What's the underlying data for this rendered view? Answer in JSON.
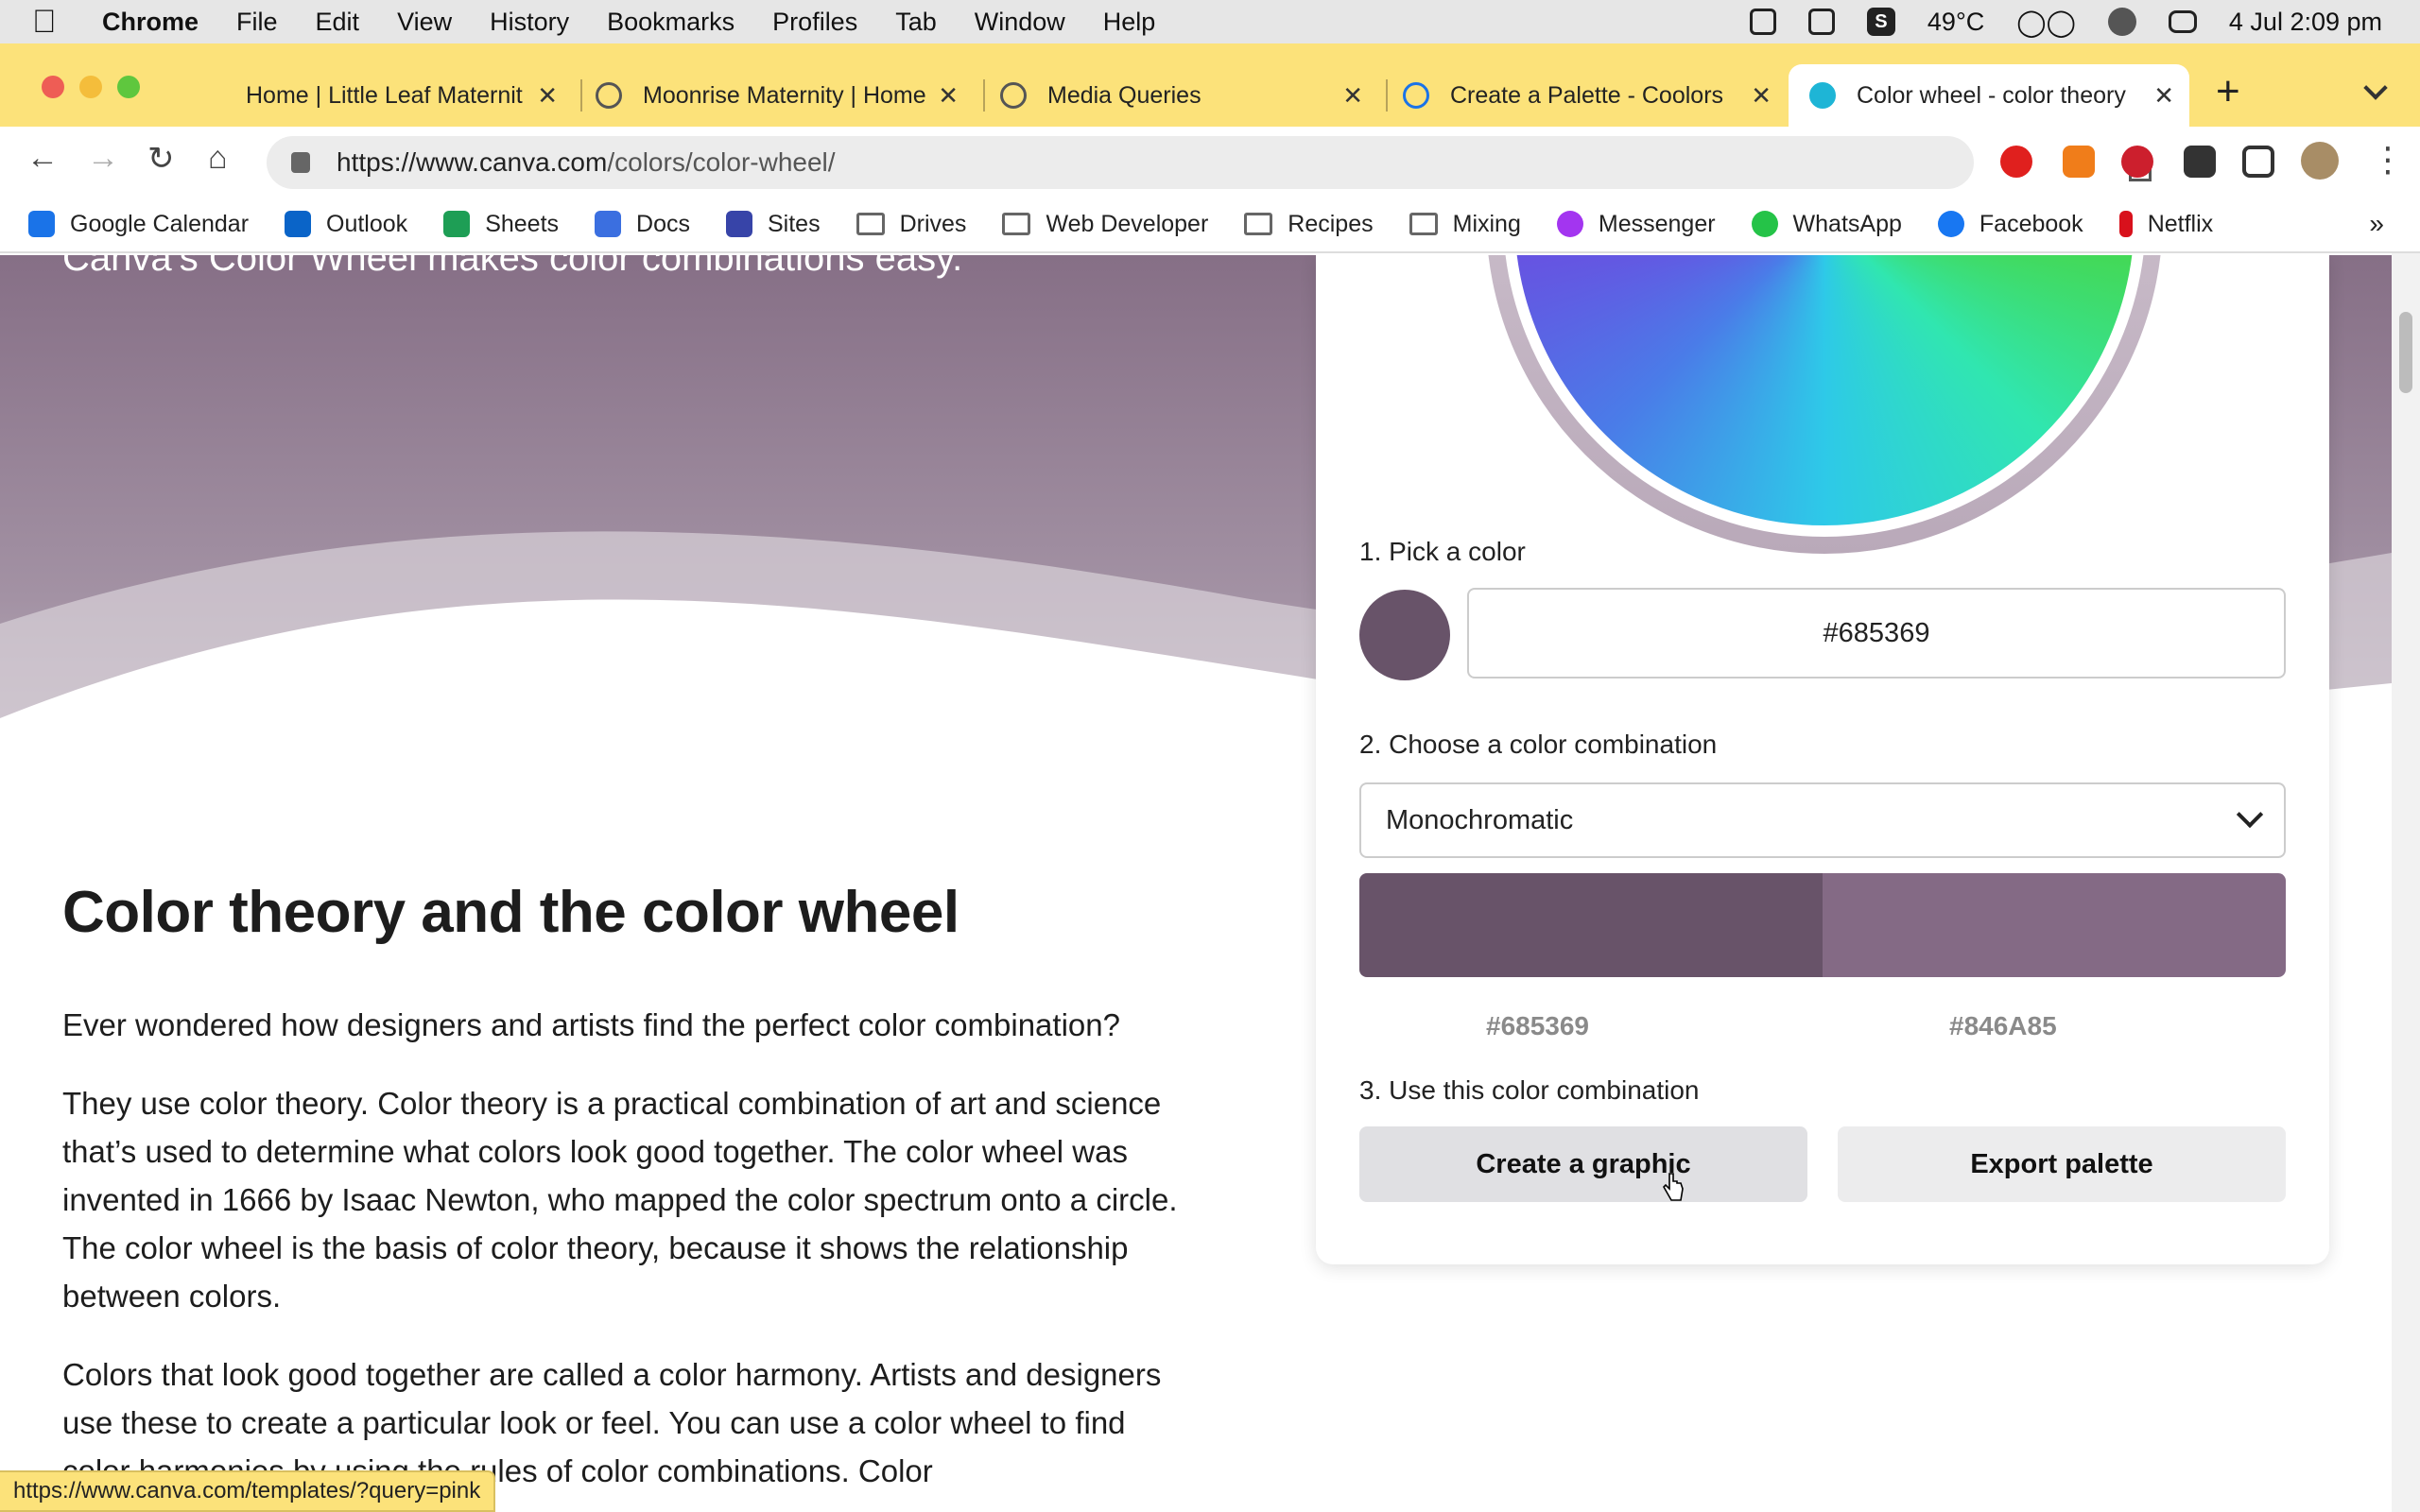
{
  "menubar": {
    "app": "Chrome",
    "items": [
      "File",
      "Edit",
      "View",
      "History",
      "Bookmarks",
      "Profiles",
      "Tab",
      "Window",
      "Help"
    ],
    "status": {
      "s_badge": "S",
      "temperature": "49°C",
      "datetime": "4 Jul  2:09 pm"
    }
  },
  "tabs": [
    {
      "title": "Home | Little Leaf Maternit",
      "icon": "leaf-favicon"
    },
    {
      "title": "Moonrise Maternity | Home",
      "icon": "globe-favicon"
    },
    {
      "title": "Media Queries",
      "icon": "globe-favicon"
    },
    {
      "title": "Create a Palette - Coolors",
      "icon": "coolors-favicon"
    },
    {
      "title": "Color wheel - color theory",
      "icon": "canva-favicon",
      "active": true
    }
  ],
  "omnibox": {
    "url_prefix": "https://www.canva.com",
    "url_path": "/colors/color-wheel/"
  },
  "bookmarks": [
    {
      "label": "Google Calendar",
      "icon": "calendar-icon",
      "color": "#1a73e8"
    },
    {
      "label": "Outlook",
      "icon": "outlook-icon",
      "color": "#0a64c8"
    },
    {
      "label": "Sheets",
      "icon": "sheets-icon",
      "color": "#1e9e55"
    },
    {
      "label": "Docs",
      "icon": "docs-icon",
      "color": "#3b6fe0"
    },
    {
      "label": "Sites",
      "icon": "sites-icon",
      "color": "#3744a8"
    },
    {
      "label": "Drives",
      "icon": "folder-icon"
    },
    {
      "label": "Web Developer",
      "icon": "folder-icon"
    },
    {
      "label": "Recipes",
      "icon": "folder-icon"
    },
    {
      "label": "Mixing",
      "icon": "folder-icon"
    },
    {
      "label": "Messenger",
      "icon": "messenger-icon",
      "color": "#a335f0"
    },
    {
      "label": "WhatsApp",
      "icon": "whatsapp-icon",
      "color": "#25c348"
    },
    {
      "label": "Facebook",
      "icon": "facebook-icon",
      "color": "#1877f2"
    },
    {
      "label": "Netflix",
      "icon": "netflix-icon",
      "color": "#d8111c"
    }
  ],
  "hero": {
    "tagline": "Canva’s Color Wheel makes color combinations easy."
  },
  "article": {
    "heading": "Color theory and the color wheel",
    "p1": "Ever wondered how designers and artists find the perfect color combination?",
    "p2": "They use color theory. Color theory is a practical combination of art and science that’s used to determine what colors look good together. The color wheel was invented in 1666 by Isaac Newton, who mapped the color spectrum onto a circle. The color wheel is the basis of color theory, because it shows the relationship between colors.",
    "p3": "Colors that look good together are called a color harmony. Artists and designers use these to create a particular look or feel. You can use a color wheel to find color harmonies by using the rules of color combinations. Color"
  },
  "tool": {
    "step1": "1. Pick a color",
    "color_value": "#685369",
    "step2": "2. Choose a color combination",
    "combination": "Monochromatic",
    "palette": [
      "#685369",
      "#846A85"
    ],
    "step3": "3. Use this color combination",
    "create_btn": "Create a graphic",
    "export_btn": "Export palette"
  },
  "status_url": "https://www.canva.com/templates/?query=pink"
}
